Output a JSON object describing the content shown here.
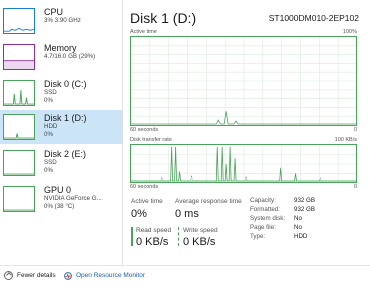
{
  "sidebar": {
    "items": [
      {
        "title": "CPU",
        "lines": [
          "3% 3.90 GHz"
        ],
        "color": "#1a7fd0"
      },
      {
        "title": "Memory",
        "lines": [
          "4.7/16.0 GB (29%)"
        ],
        "color": "#8b2f9e"
      },
      {
        "title": "Disk 0 (C:)",
        "lines": [
          "SSD",
          "0%"
        ],
        "color": "#4aa35a"
      },
      {
        "title": "Disk 1 (D:)",
        "lines": [
          "HDD",
          "0%"
        ],
        "color": "#4aa35a"
      },
      {
        "title": "Disk 2 (E:)",
        "lines": [
          "SSD",
          "0%"
        ],
        "color": "#4aa35a"
      },
      {
        "title": "GPU 0",
        "lines": [
          "NVIDIA GeForce G...",
          "0% (38 °C)"
        ],
        "color": "#4aa35a"
      }
    ]
  },
  "main": {
    "title": "Disk 1 (D:)",
    "model": "ST1000DM010-2EP102",
    "active_time_graph": {
      "label": "Active time",
      "max": "100%",
      "time_left": "60 seconds",
      "time_right": "0"
    },
    "transfer_graph": {
      "label": "Disk transfer rate",
      "max": "100 KB/s",
      "time_left": "60 seconds",
      "time_right": "0"
    },
    "stats": {
      "active_time_label": "Active time",
      "active_time_value": "0%",
      "avg_response_label": "Average response time",
      "avg_response_value": "0 ms",
      "read_speed_label": "Read speed",
      "read_speed_value": "0 KB/s",
      "write_speed_label": "Write speed",
      "write_speed_value": "0 KB/s"
    },
    "properties": [
      {
        "key": "Capacity:",
        "value": "932 GB"
      },
      {
        "key": "Formatted:",
        "value": "932 GB"
      },
      {
        "key": "System disk:",
        "value": "No"
      },
      {
        "key": "Page file:",
        "value": "No"
      },
      {
        "key": "Type:",
        "value": "HDD"
      }
    ],
    "accent_color": "#4aa35a"
  },
  "footer": {
    "fewer_details": "Fewer details",
    "open_resource_monitor": "Open Resource Monitor"
  }
}
